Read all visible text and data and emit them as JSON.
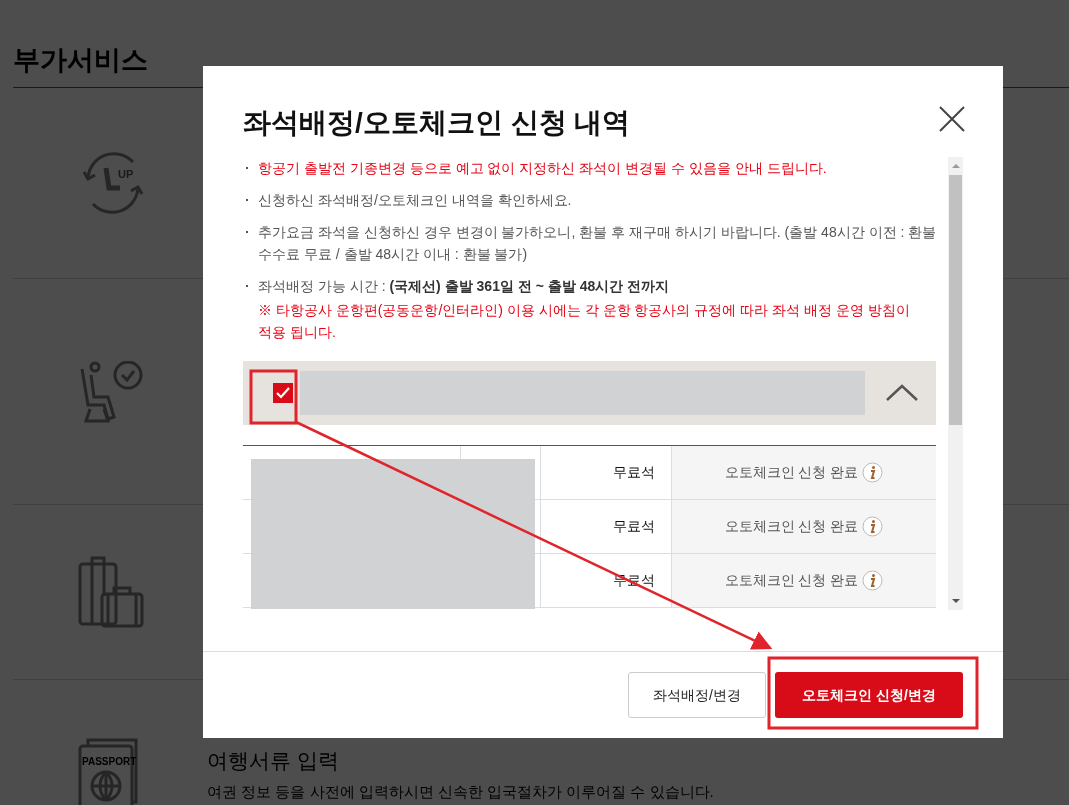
{
  "page": {
    "title": "부가서비스",
    "upgrade_icon_text": "UP",
    "documents": {
      "icon_text": "PASSPORT",
      "title": "여행서류 입력",
      "description": "여권 정보 등을 사전에 입력하시면 신속한 입국절차가 이루어질 수 있습니다."
    }
  },
  "modal": {
    "title": "좌석배정/오토체크인 신청 내역",
    "notes": [
      {
        "kind": "warning",
        "text": "항공기 출발전 기종변경 등으로 예고 없이 지정하신 좌석이 변경될 수 있음을 안내 드립니다."
      },
      {
        "kind": "info",
        "text": "신청하신 좌석배정/오토체크인 내역을 확인하세요."
      },
      {
        "kind": "info",
        "text": "추가요금 좌석을 신청하신 경우 변경이 불가하오니, 환불 후 재구매 하시기 바랍니다. (출발 48시간 이전 : 환불 수수료 무료 / 출발 48시간 이내 : 환불 불가)"
      },
      {
        "kind": "info",
        "text": "좌석배정 가능 시간 : **(국제선) 출발 361일 전 ~ 출발 48시간 전까지**",
        "sub_warning": "※ 타항공사 운항편(공동운항/인터라인) 이용 시에는 각 운항 항공사의 규정에 따라 좌석 배정 운영 방침이 적용 됩니다."
      }
    ],
    "booking": {
      "checked": true,
      "expanded": true,
      "rows": [
        {
          "seat_type": "무료석",
          "status": "오토체크인 신청 완료"
        },
        {
          "seat_type": "무료석",
          "status": "오토체크인 신청 완료"
        },
        {
          "seat_type": "무료석",
          "status": "오토체크인 신청 완료"
        }
      ]
    },
    "buttons": [
      {
        "label": "좌석배정/변경",
        "primary": false
      },
      {
        "label": "오토체크인 신청/변경",
        "primary": true
      }
    ]
  }
}
